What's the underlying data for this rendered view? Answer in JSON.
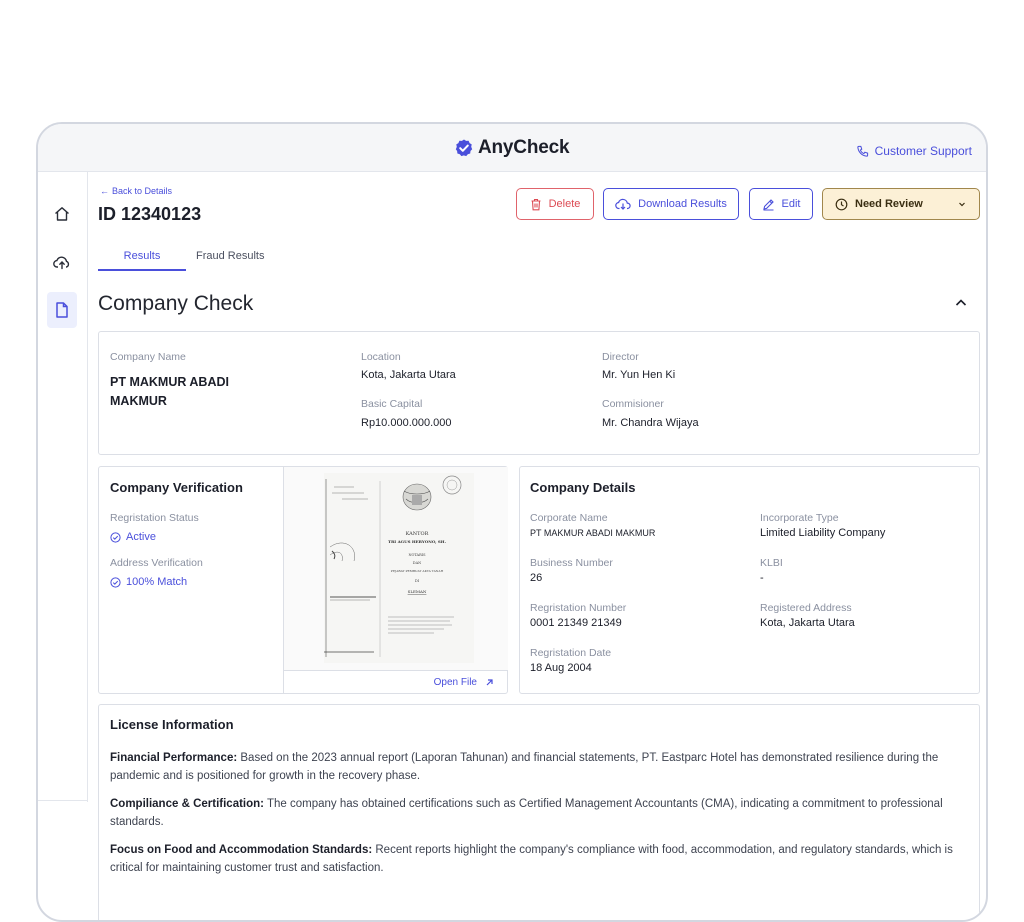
{
  "app": {
    "brand": "AnyCheck",
    "support_label": "Customer Support"
  },
  "colors": {
    "accent": "#4a4fdb",
    "danger": "#dc4a53",
    "review_bg": "#fcf0d6",
    "review_border": "#a1874c"
  },
  "sidebar": {
    "items": [
      {
        "icon": "home-icon",
        "active": false
      },
      {
        "icon": "cloud-upload-icon",
        "active": false
      },
      {
        "icon": "document-icon",
        "active": true
      }
    ]
  },
  "header": {
    "back_label": "Back to Details",
    "id_label": "ID 12340123"
  },
  "actions": {
    "delete": "Delete",
    "download": "Download Results",
    "edit": "Edit",
    "status": "Need Review"
  },
  "tabs": [
    {
      "label": "Results",
      "active": true
    },
    {
      "label": "Fraud Results",
      "active": false
    }
  ],
  "section": {
    "title": "Company Check"
  },
  "summary": {
    "company_name_label": "Company Name",
    "company_name_line1": "PT MAKMUR ABADI",
    "company_name_line2": "MAKMUR",
    "location_label": "Location",
    "location": "Kota, Jakarta Utara",
    "capital_label": "Basic Capital",
    "capital": "Rp10.000.000.000",
    "director_label": "Director",
    "director": "Mr. Yun Hen Ki",
    "commisioner_label": "Commisioner",
    "commisioner": "Mr. Chandra Wijaya"
  },
  "verification": {
    "title": "Company Verification",
    "reg_status_label": "Regristation Status",
    "reg_status": "Active",
    "address_label": "Address Verification",
    "address_status": "100% Match",
    "open_file": "Open File"
  },
  "details": {
    "title": "Company Details",
    "corporate_name_label": "Corporate Name",
    "corporate_name": "PT MAKMUR ABADI MAKMUR",
    "incorporate_type_label": "Incorporate Type",
    "incorporate_type": "Limited Liability Company",
    "business_number_label": "Business Number",
    "business_number": "26",
    "klbi_label": "KLBI",
    "klbi": "-",
    "reg_number_label": "Regristation Number",
    "reg_number": "0001 21349 21349",
    "registered_address_label": "Registered Address",
    "registered_address": "Kota, Jakarta Utara",
    "reg_date_label": "Regristation Date",
    "reg_date": "18 Aug 2004"
  },
  "license": {
    "title": "License Information",
    "paragraphs": [
      {
        "head": "Financial Performance:",
        "body": " Based on the 2023 annual report (Laporan Tahunan) and financial statements, PT. Eastparc Hotel has demonstrated resilience during the pandemic and is positioned for growth in the recovery phase."
      },
      {
        "head": "Compiliance & Certification:",
        "body": " The company has obtained certifications such as Certified Management Accountants (CMA), indicating a commitment to professional standards."
      },
      {
        "head": "Focus on Food and Accommodation Standards:",
        "body": " Recent reports highlight the company's compliance with food, accommodation, and regulatory standards, which is critical for maintaining customer trust and satisfaction."
      }
    ]
  },
  "document_preview": {
    "office_label": "KANTOR",
    "notary_name": "TRI AGUS HERYONO, SH.",
    "doc_line_1": "NOTARIS",
    "doc_line_2": "DAN",
    "doc_line_3": "PEJABAT PEMBUAT AKTA TANAH",
    "doc_line_4": "DI",
    "doc_line_5": "SLEMAN"
  }
}
